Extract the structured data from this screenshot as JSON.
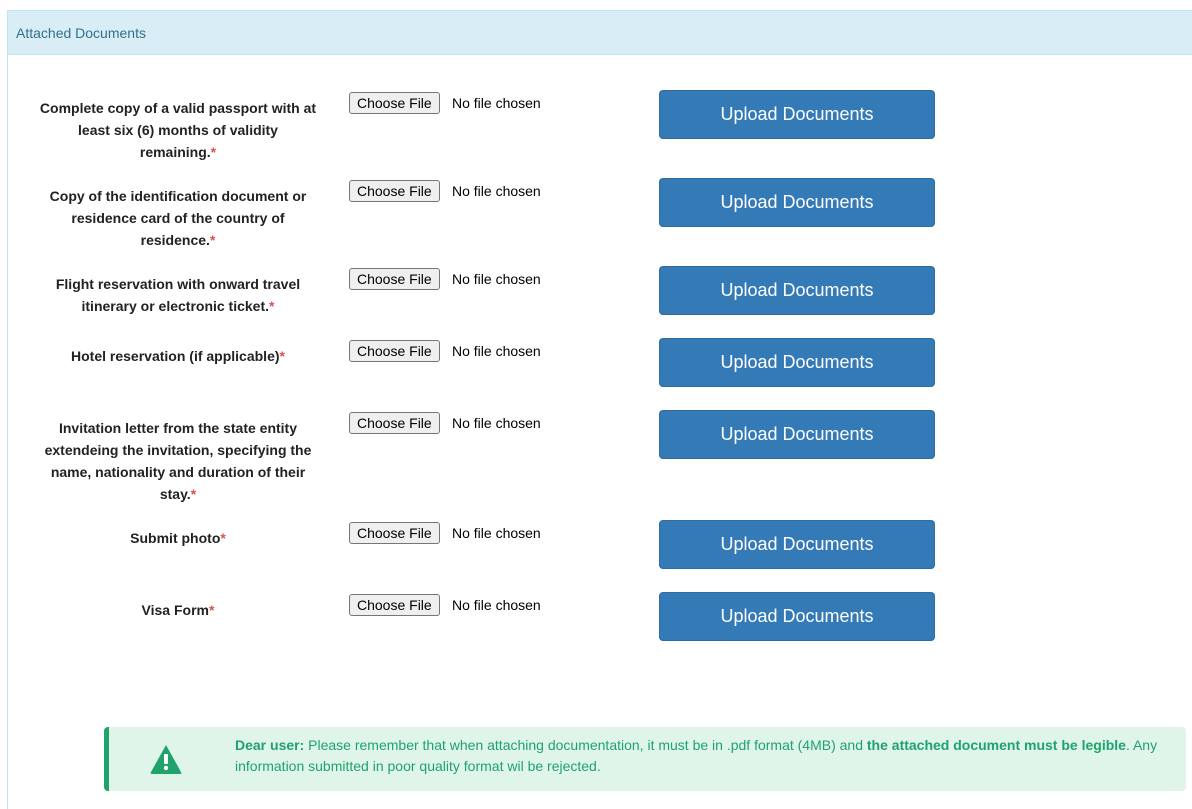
{
  "panel": {
    "title": "Attached Documents"
  },
  "documents": [
    {
      "label": "Complete copy of a valid passport with at least six (6) months of validity remaining.",
      "required": "*",
      "file_button": "Choose File",
      "file_status": "No file chosen",
      "upload_label": "Upload Documents"
    },
    {
      "label": "Copy of the identification document or residence card of the country of residence.",
      "required": "*",
      "file_button": "Choose File",
      "file_status": "No file chosen",
      "upload_label": "Upload Documents"
    },
    {
      "label": "Flight reservation with onward travel itinerary or electronic ticket.",
      "required": "*",
      "file_button": "Choose File",
      "file_status": "No file chosen",
      "upload_label": "Upload Documents"
    },
    {
      "label": "Hotel reservation (if applicable)",
      "required": "*",
      "file_button": "Choose File",
      "file_status": "No file chosen",
      "upload_label": "Upload Documents"
    },
    {
      "label": "Invitation letter from the state entity extendeing the invitation, specifying the name, nationality and duration of their stay.",
      "required": "*",
      "file_button": "Choose File",
      "file_status": "No file chosen",
      "upload_label": "Upload Documents"
    },
    {
      "label": "Submit photo",
      "required": "*",
      "file_button": "Choose File",
      "file_status": "No file chosen",
      "upload_label": "Upload Documents"
    },
    {
      "label": "Visa Form",
      "required": "*",
      "file_button": "Choose File",
      "file_status": "No file chosen",
      "upload_label": "Upload Documents"
    }
  ],
  "notice": {
    "icon": "warning-icon",
    "lead": "Dear user:",
    "text1": " Please remember that when attaching documentation, it must be in .pdf format (4MB) and ",
    "bold": "the attached document must be legible",
    "text2": ". Any information submitted in poor quality format wil be rejected.",
    "color": "#1fa36a"
  },
  "colors": {
    "primary": "#337ab7",
    "heading_bg": "#d9edf7",
    "required": "#d9534f"
  }
}
